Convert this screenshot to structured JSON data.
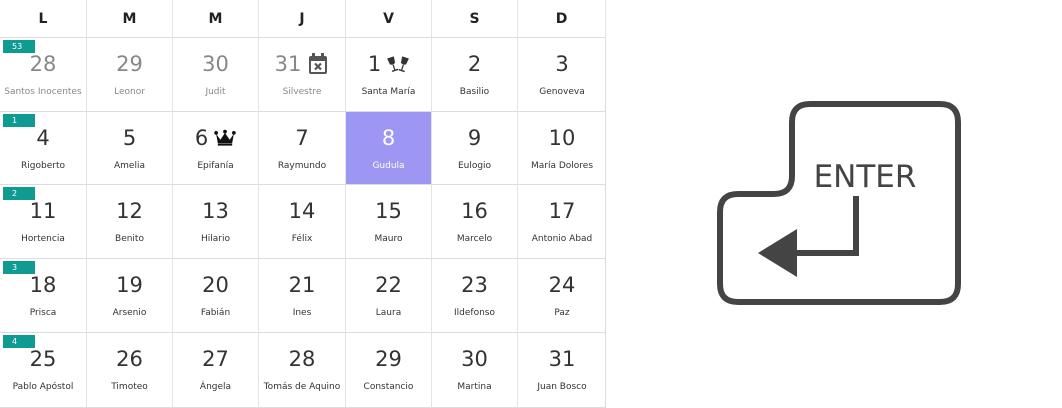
{
  "weekdays": [
    "L",
    "M",
    "M",
    "J",
    "V",
    "S",
    "D"
  ],
  "weeks": [
    {
      "week_number": "53",
      "days": [
        {
          "num": "28",
          "saint": "Santos Inocentes",
          "muted": true
        },
        {
          "num": "29",
          "saint": "Leonor",
          "muted": true
        },
        {
          "num": "30",
          "saint": "Judit",
          "muted": true
        },
        {
          "num": "31",
          "saint": "Silvestre",
          "muted": true,
          "icon": "calendar-x-icon"
        },
        {
          "num": "1",
          "saint": "Santa María",
          "icon": "champagne-toast-icon"
        },
        {
          "num": "2",
          "saint": "Basilio"
        },
        {
          "num": "3",
          "saint": "Genoveva"
        }
      ]
    },
    {
      "week_number": "1",
      "days": [
        {
          "num": "4",
          "saint": "Rigoberto"
        },
        {
          "num": "5",
          "saint": "Amelia"
        },
        {
          "num": "6",
          "saint": "Epifanía",
          "icon": "crown-icon"
        },
        {
          "num": "7",
          "saint": "Raymundo"
        },
        {
          "num": "8",
          "saint": "Gudula",
          "selected": true
        },
        {
          "num": "9",
          "saint": "Eulogio"
        },
        {
          "num": "10",
          "saint": "María Dolores"
        }
      ]
    },
    {
      "week_number": "2",
      "days": [
        {
          "num": "11",
          "saint": "Hortencia"
        },
        {
          "num": "12",
          "saint": "Benito"
        },
        {
          "num": "13",
          "saint": "Hilario"
        },
        {
          "num": "14",
          "saint": "Félix"
        },
        {
          "num": "15",
          "saint": "Mauro"
        },
        {
          "num": "16",
          "saint": "Marcelo"
        },
        {
          "num": "17",
          "saint": "Antonio Abad"
        }
      ]
    },
    {
      "week_number": "3",
      "days": [
        {
          "num": "18",
          "saint": "Prisca"
        },
        {
          "num": "19",
          "saint": "Arsenio"
        },
        {
          "num": "20",
          "saint": "Fabián"
        },
        {
          "num": "21",
          "saint": "Ines"
        },
        {
          "num": "22",
          "saint": "Laura"
        },
        {
          "num": "23",
          "saint": "Ildefonso"
        },
        {
          "num": "24",
          "saint": "Paz"
        }
      ]
    },
    {
      "week_number": "4",
      "days": [
        {
          "num": "25",
          "saint": "Pablo Apóstol"
        },
        {
          "num": "26",
          "saint": "Timoteo"
        },
        {
          "num": "27",
          "saint": "Ángela"
        },
        {
          "num": "28",
          "saint": "Tomás de Aquino"
        },
        {
          "num": "29",
          "saint": "Constancio"
        },
        {
          "num": "30",
          "saint": "Martina"
        },
        {
          "num": "31",
          "saint": "Juan Bosco"
        }
      ]
    }
  ],
  "enter_key": {
    "label": "ENTER",
    "icon": "return-arrow-icon"
  },
  "colors": {
    "selected_day": "#9b97f2",
    "week_badge": "#0f9b91",
    "key_outline": "#444444"
  }
}
